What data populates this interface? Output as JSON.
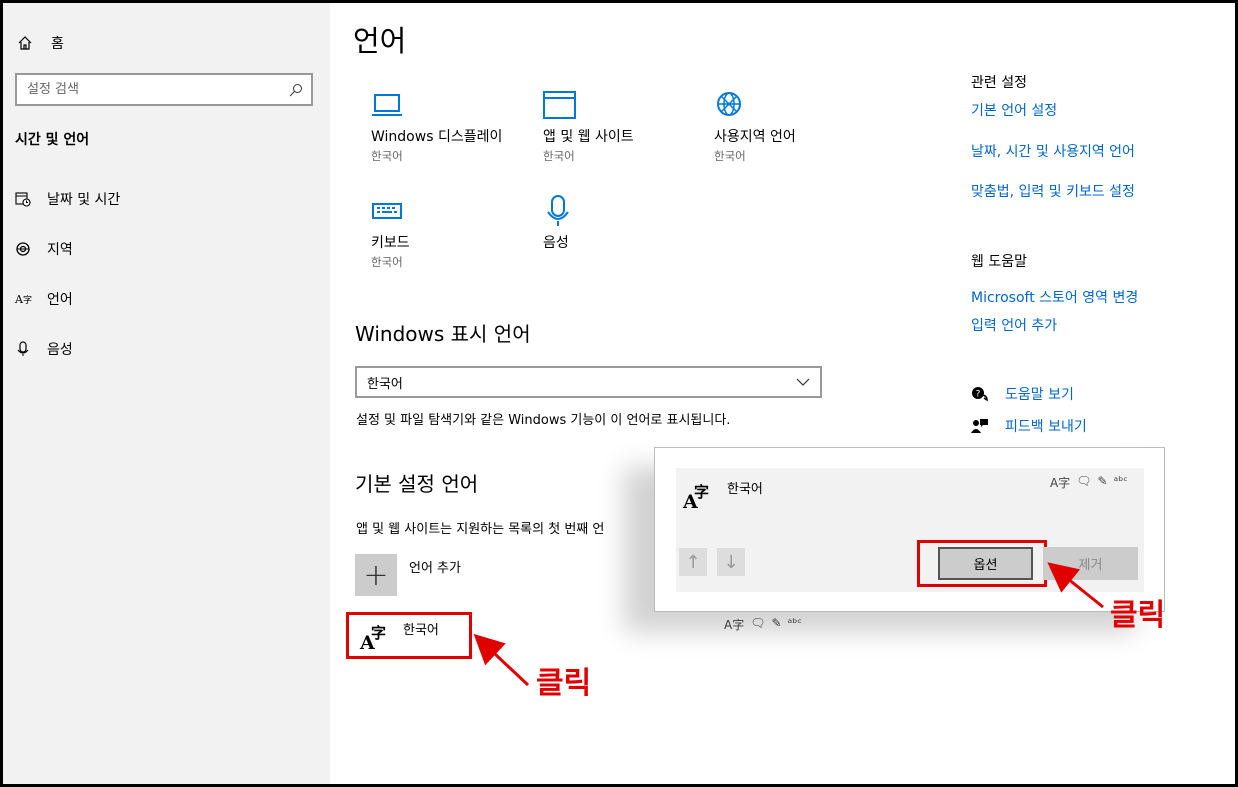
{
  "sidebar": {
    "home_label": "홈",
    "search_placeholder": "설정 검색",
    "section_title": "시간 및 언어",
    "items": [
      {
        "label": "날짜 및 시간",
        "icon": "calendar-clock-icon"
      },
      {
        "label": "지역",
        "icon": "globe-icon"
      },
      {
        "label": "언어",
        "icon": "language-icon"
      },
      {
        "label": "음성",
        "icon": "microphone-icon"
      }
    ]
  },
  "main": {
    "title": "언어",
    "tiles": [
      {
        "name": "Windows 디스플레이",
        "sub": "한국어",
        "icon": "monitor-icon"
      },
      {
        "name": "앱 및 웹 사이트",
        "sub": "한국어",
        "icon": "browser-window-icon"
      },
      {
        "name": "사용지역 언어",
        "sub": "한국어",
        "icon": "region-globe-icon"
      },
      {
        "name": "키보드",
        "sub": "한국어",
        "icon": "keyboard-icon"
      },
      {
        "name": "음성",
        "sub": "",
        "icon": "microphone-icon"
      }
    ],
    "display_language": {
      "heading": "Windows 표시 언어",
      "selected": "한국어",
      "description": "설정 및 파일 탐색기와 같은 Windows 기능이 이 언어로 표시됩니다."
    },
    "preferred": {
      "heading": "기본 설정 언어",
      "description": "앱 및 웹 사이트는 지원하는 목록의 첫 번째 언",
      "add_label": "언어 추가",
      "language_name": "한국어"
    }
  },
  "right": {
    "related_heading": "관련 설정",
    "related_links": [
      "기본 언어 설정",
      "날짜, 시간 및 사용지역 언어",
      "맞춤법, 입력 및 키보드 설정"
    ],
    "web_help_heading": "웹 도움말",
    "web_links": [
      "Microsoft 스토어 영역 변경",
      "입력 언어 추가"
    ],
    "help_label": "도움말 보기",
    "feedback_label": "피드백 보내기"
  },
  "popup": {
    "language_name": "한국어",
    "options_label": "옵션",
    "remove_label": "제거"
  },
  "annotations": {
    "click_1": "클릭",
    "click_2": "클릭"
  },
  "colors": {
    "accent": "#0078d7",
    "link": "#0066cc",
    "highlight": "#e00000",
    "sidebar_bg": "#f2f2f2"
  }
}
